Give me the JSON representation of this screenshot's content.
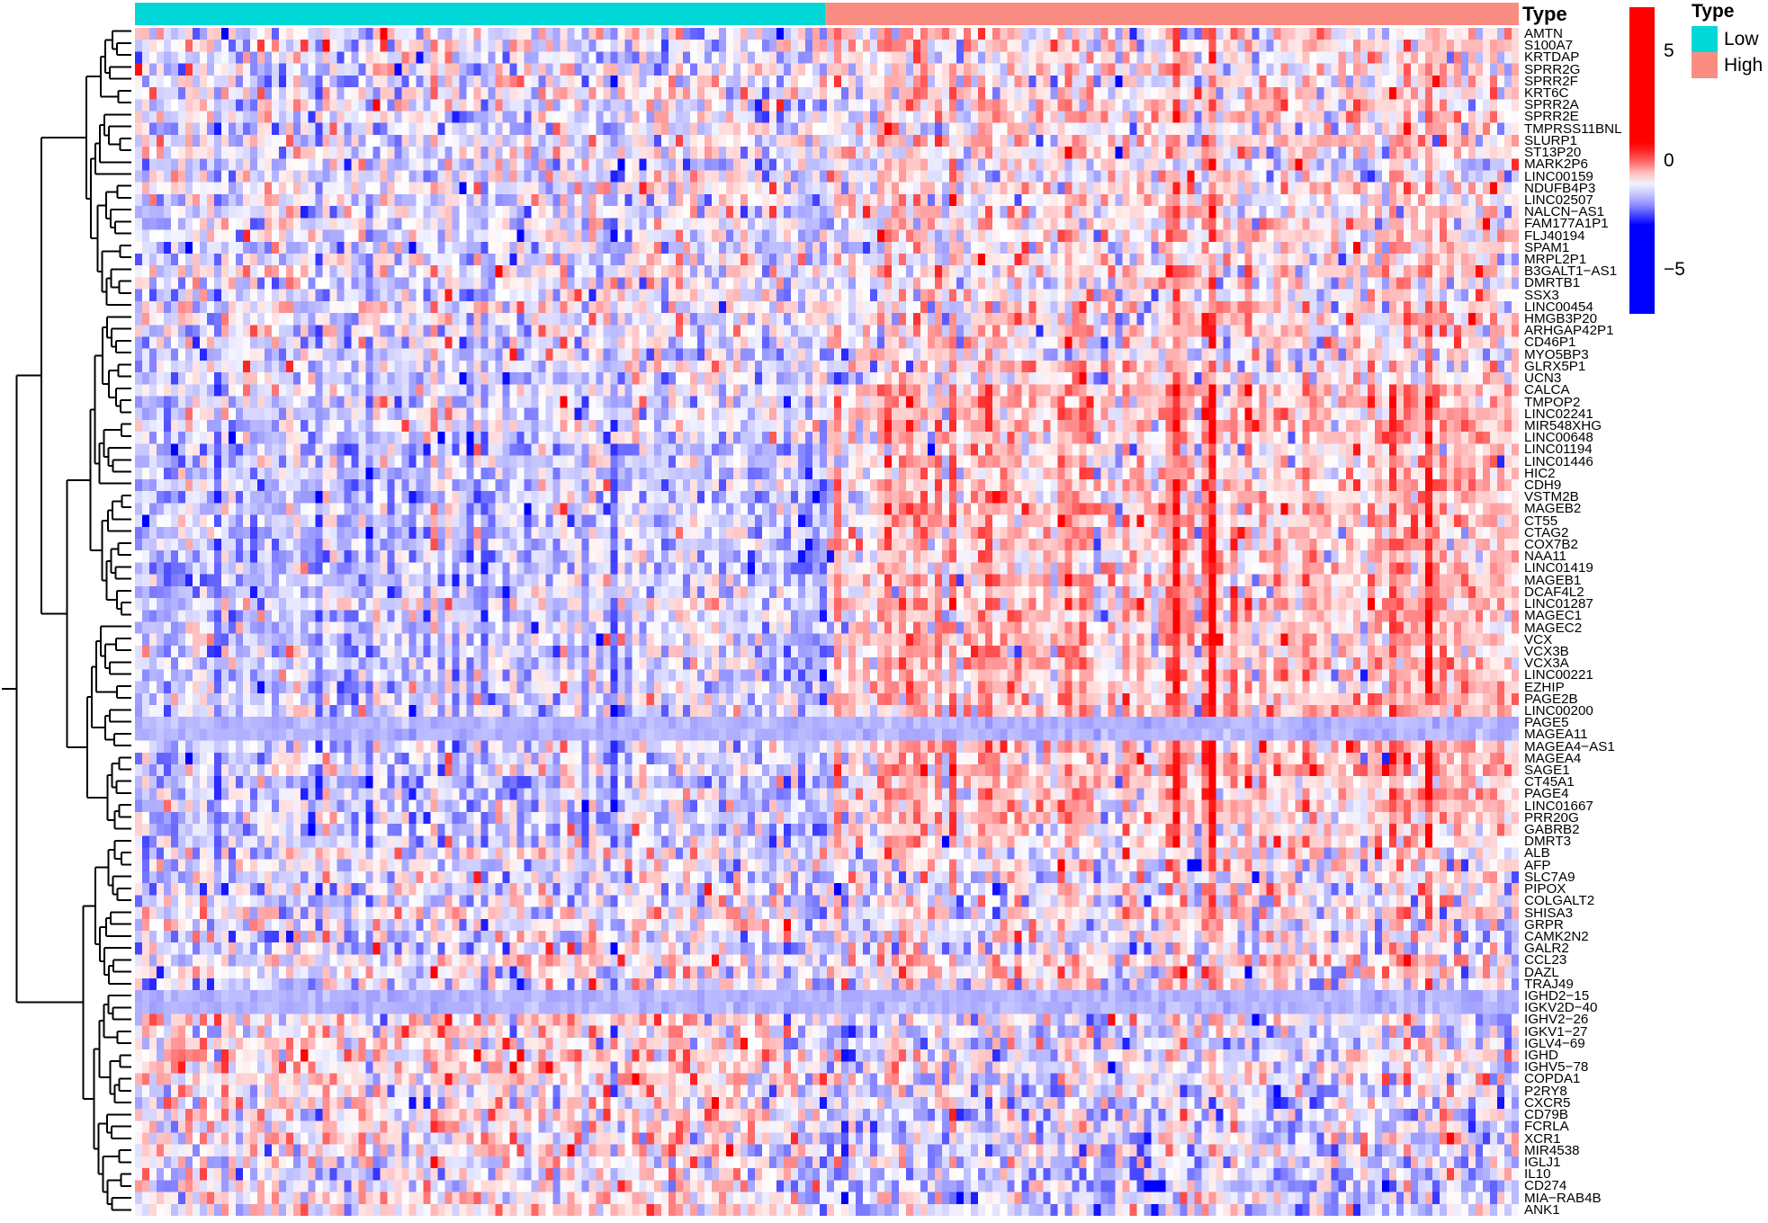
{
  "chart_data": {
    "type": "heatmap",
    "title": "",
    "xlabel": "",
    "ylabel": "",
    "description": "Clustered expression heatmap of differentially expressed genes across samples, split into Low and High Type groups with a row dendrogram.",
    "value_range": [
      -7,
      7
    ],
    "colorscale": {
      "name": "blue-white-red",
      "low_color": "#0000FF",
      "mid_color": "#FFFFFF",
      "high_color": "#FF0000",
      "ticks": [
        "5",
        "0",
        "−5"
      ],
      "tick_values": [
        5,
        0,
        -5
      ]
    },
    "grid": false,
    "legend_position": "right",
    "column_groups": [
      {
        "label": "Low",
        "color": "#00D8D8",
        "fraction": 0.499
      },
      {
        "label": "High",
        "color": "#FA8D82",
        "fraction": 0.501
      }
    ],
    "n_columns": 192,
    "row_labels": [
      "AMTN",
      "S100A7",
      "KRTDAP",
      "SPRR2G",
      "SPRR2F",
      "KRT6C",
      "SPRR2A",
      "SPRR2E",
      "TMPRSS11BNL",
      "SLURP1",
      "ST13P20",
      "MARK2P6",
      "LINC00159",
      "NDUFB4P3",
      "LINC02507",
      "NALCN−AS1",
      "FAM177A1P1",
      "FLJ40194",
      "SPAM1",
      "MRPL2P1",
      "B3GALT1−AS1",
      "DMRTB1",
      "SSX3",
      "LINC00454",
      "HMGB3P20",
      "ARHGAP42P1",
      "CD46P1",
      "MYO5BP3",
      "GLRX5P1",
      "UCN3",
      "CALCA",
      "TMPOP2",
      "LINC02241",
      "MIR548XHG",
      "LINC00648",
      "LINC01194",
      "LINC01446",
      "HIC2",
      "CDH9",
      "VSTM2B",
      "MAGEB2",
      "CT55",
      "CTAG2",
      "COX7B2",
      "NAA11",
      "LINC01419",
      "MAGEB1",
      "DCAF4L2",
      "LINC01287",
      "MAGEC1",
      "MAGEC2",
      "VCX",
      "VCX3B",
      "VCX3A",
      "LINC00221",
      "EZHIP",
      "PAGE2B",
      "LINC00200",
      "PAGE5",
      "MAGEA11",
      "MAGEA4−AS1",
      "MAGEA4",
      "SAGE1",
      "CT45A1",
      "PAGE4",
      "LINC01667",
      "PRR20G",
      "GABRB2",
      "DMRT3",
      "ALB",
      "AFP",
      "SLC7A9",
      "PIPOX",
      "COLGALT2",
      "SHISA3",
      "GRPR",
      "CAMK2N2",
      "GALR2",
      "CCL23",
      "DAZL",
      "TRAJ49",
      "IGHD2−15",
      "IGKV2D−40",
      "IGHV2−26",
      "IGKV1−27",
      "IGLV4−69",
      "IGHD",
      "IGHV5−78",
      "COPDA1",
      "P2RY8",
      "CXCR5",
      "CD79B",
      "FCRLA",
      "XCR1",
      "MIR4538",
      "IGLJ1",
      "IL10",
      "CD274",
      "MIA−RAB4B",
      "ANK1"
    ]
  },
  "annotation": {
    "title": "Type"
  },
  "legend": {
    "type_title": "Type",
    "entries": [
      {
        "label": "Low",
        "color": "#00D8D8"
      },
      {
        "label": "High",
        "color": "#FA8D82"
      }
    ],
    "scale_ticks": [
      {
        "label": "5",
        "value": 5
      },
      {
        "label": "0",
        "value": 0
      },
      {
        "label": "−5",
        "value": -5
      }
    ]
  }
}
